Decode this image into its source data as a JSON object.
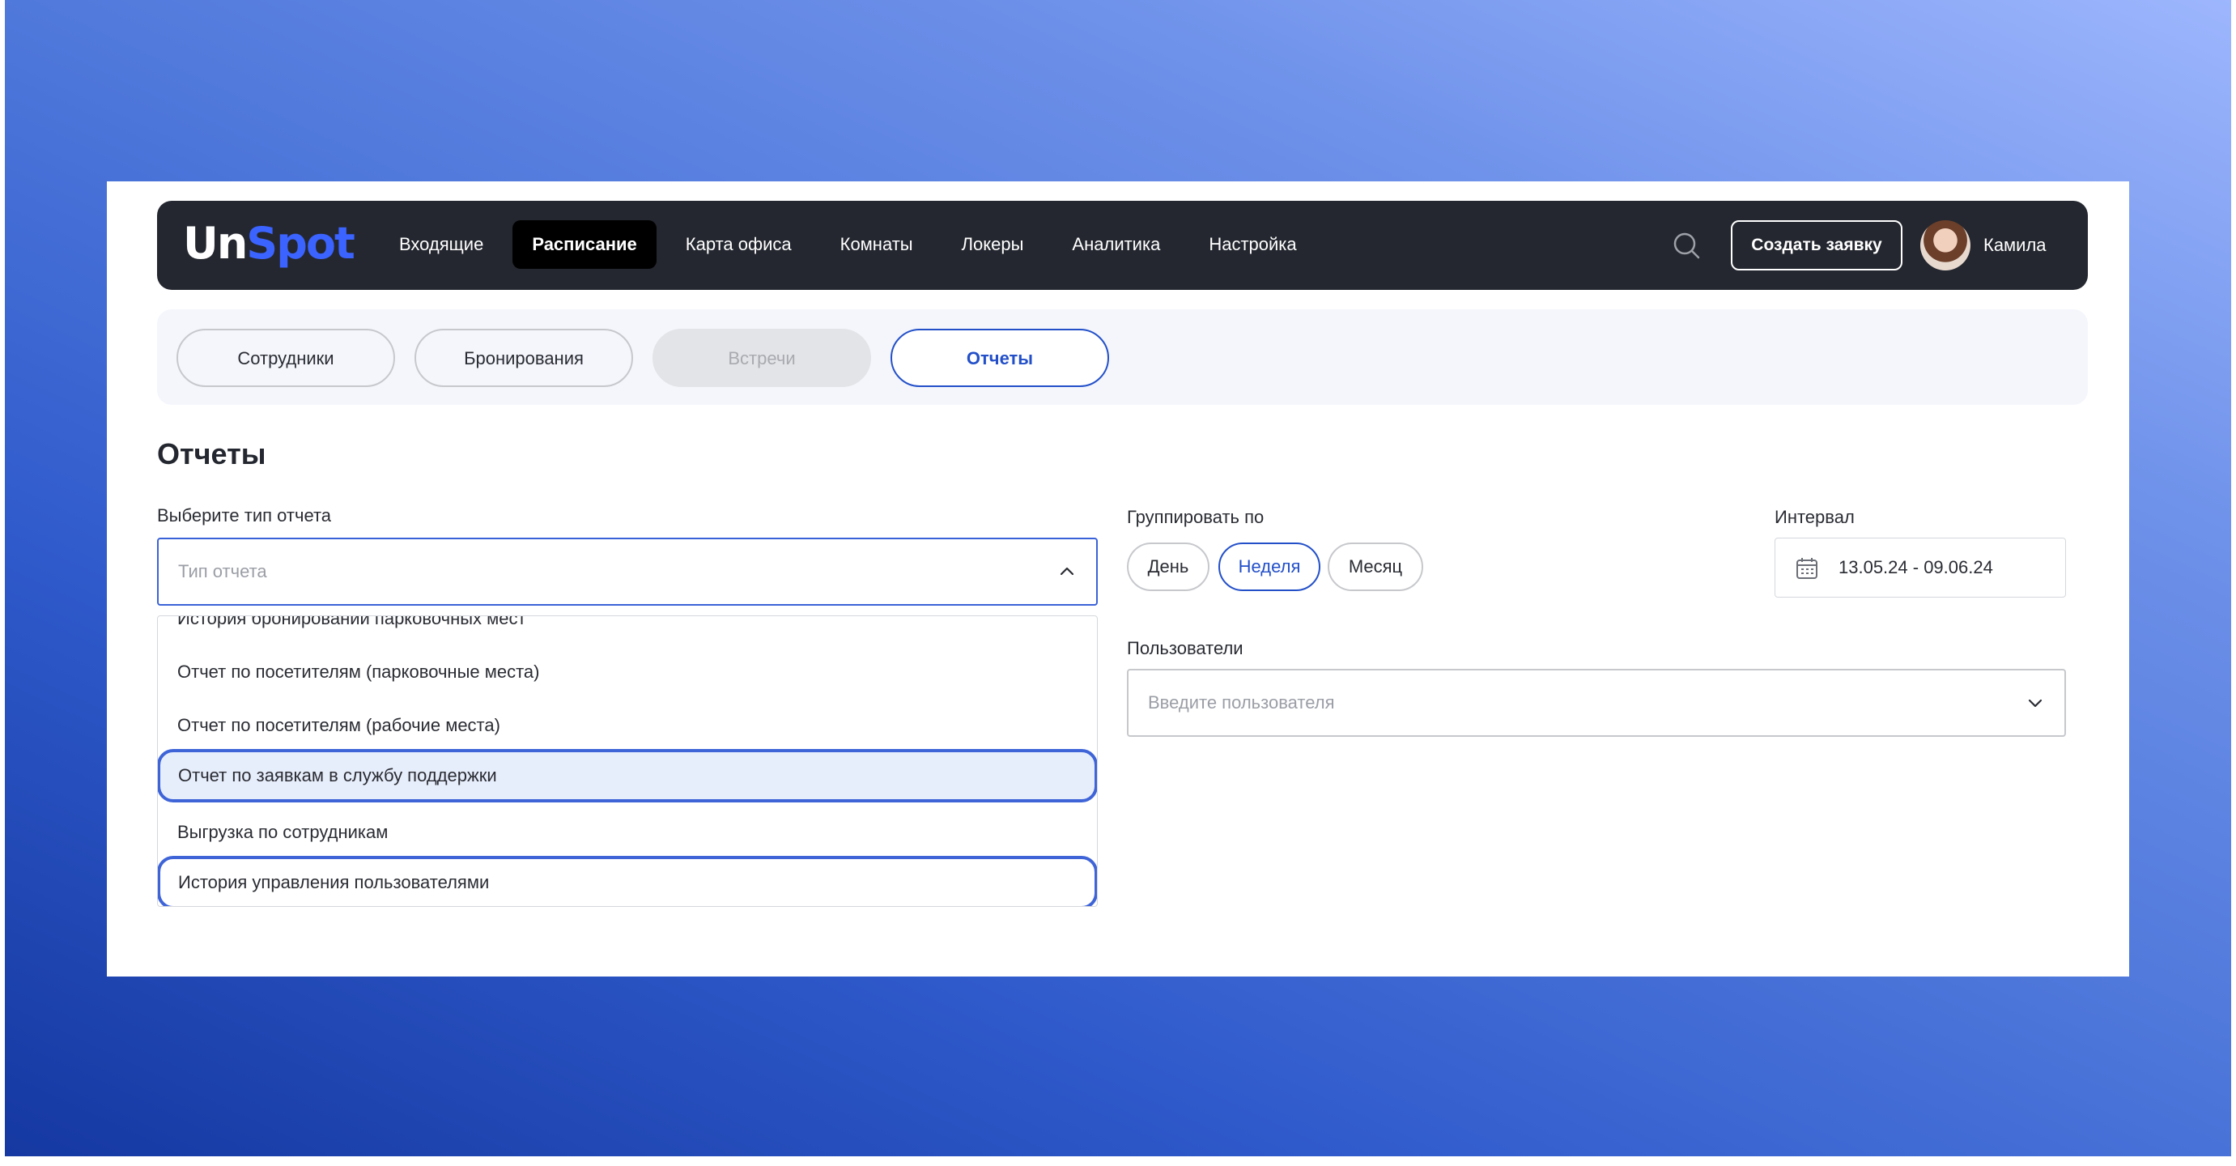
{
  "brand": {
    "logo_part1": "Un",
    "logo_part2": "Spot"
  },
  "nav": {
    "items": [
      {
        "label": "Входящие",
        "active": false
      },
      {
        "label": "Расписание",
        "active": true
      },
      {
        "label": "Карта офиса",
        "active": false
      },
      {
        "label": "Комнаты",
        "active": false
      },
      {
        "label": "Локеры",
        "active": false
      },
      {
        "label": "Аналитика",
        "active": false
      },
      {
        "label": "Настройка",
        "active": false
      }
    ],
    "search_icon": "search-icon",
    "create_button": "Создать заявку",
    "user_name": "Камила"
  },
  "subtabs": [
    {
      "label": "Сотрудники",
      "state": "normal"
    },
    {
      "label": "Бронирования",
      "state": "normal"
    },
    {
      "label": "Встречи",
      "state": "disabled"
    },
    {
      "label": "Отчеты",
      "state": "active"
    }
  ],
  "page": {
    "title": "Отчеты"
  },
  "report_type": {
    "label": "Выберите тип отчета",
    "placeholder": "Тип отчета",
    "options": [
      "История бронирований парковочных мест",
      "Отчет по посетителям (парковочные места)",
      "Отчет по посетителям (рабочие места)",
      "Отчет по заявкам в службу поддержки",
      "Выгрузка по сотрудникам",
      "История управления пользователями"
    ]
  },
  "group_by": {
    "label": "Группировать по",
    "options": [
      {
        "label": "День",
        "active": false
      },
      {
        "label": "Неделя",
        "active": true
      },
      {
        "label": "Месяц",
        "active": false
      }
    ]
  },
  "interval": {
    "label": "Интервал",
    "value": "13.05.24 - 09.06.24"
  },
  "users": {
    "label": "Пользователи",
    "placeholder": "Введите пользователя"
  },
  "colors": {
    "accent": "#2350c9",
    "navbar": "#24272f",
    "highlight": "#e7eefb"
  }
}
